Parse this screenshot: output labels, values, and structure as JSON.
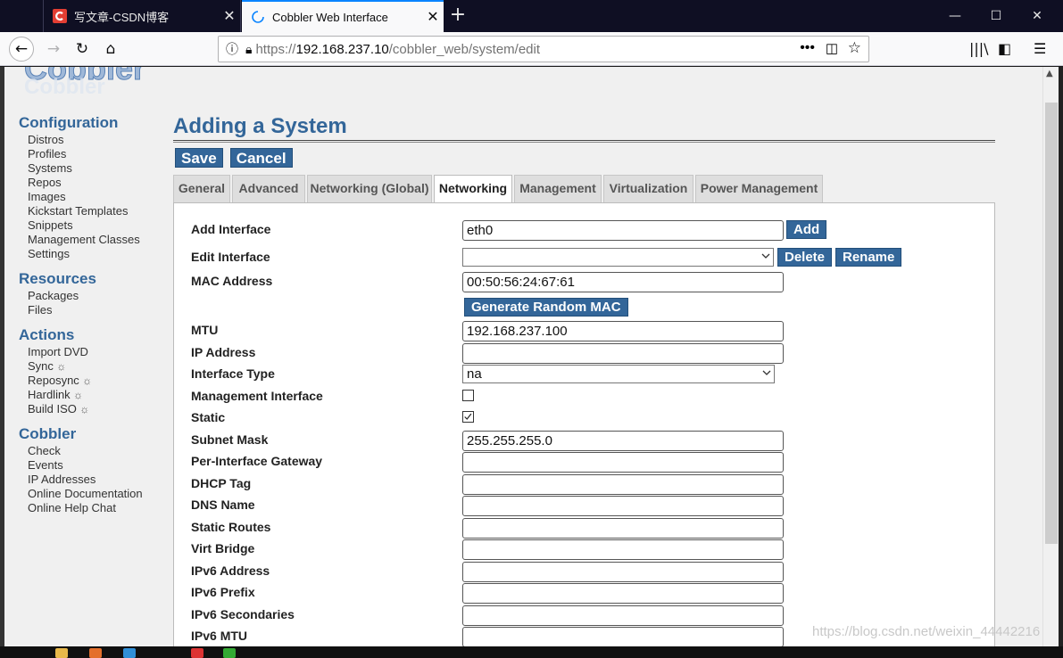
{
  "browser": {
    "tabs": [
      {
        "title": "写文章-CSDN博客",
        "active": false,
        "favicon": "csdn-c-logo"
      },
      {
        "title": "Cobbler Web Interface",
        "active": true,
        "favicon": "loading-spinner-icon"
      }
    ],
    "url": {
      "prefix": "https://",
      "host": "192.168.237.10",
      "path": "/cobbler_web/system/edit"
    },
    "colors": {
      "accent": "#0a84ff",
      "tab_bar": "#0f0f23"
    }
  },
  "page": {
    "logo_text": "Cobbler",
    "title": "Adding a System",
    "buttons": {
      "save": "Save",
      "cancel": "Cancel"
    },
    "colors": {
      "brand_blue": "#336699"
    }
  },
  "sidebar": {
    "sections": [
      {
        "heading": "Configuration",
        "items": [
          {
            "label": "Distros"
          },
          {
            "label": "Profiles"
          },
          {
            "label": "Systems"
          },
          {
            "label": "Repos"
          },
          {
            "label": "Images"
          },
          {
            "label": "Kickstart Templates"
          },
          {
            "label": "Snippets"
          },
          {
            "label": "Management Classes"
          },
          {
            "label": "Settings"
          }
        ]
      },
      {
        "heading": "Resources",
        "items": [
          {
            "label": "Packages"
          },
          {
            "label": "Files"
          }
        ]
      },
      {
        "heading": "Actions",
        "items": [
          {
            "label": "Import DVD"
          },
          {
            "label": "Sync",
            "icon": "sun-icon"
          },
          {
            "label": "Reposync",
            "icon": "sun-icon"
          },
          {
            "label": "Hardlink",
            "icon": "sun-icon"
          },
          {
            "label": "Build ISO",
            "icon": "sun-icon"
          }
        ]
      },
      {
        "heading": "Cobbler",
        "items": [
          {
            "label": "Check"
          },
          {
            "label": "Events"
          },
          {
            "label": "IP Addresses"
          },
          {
            "label": "Online Documentation"
          },
          {
            "label": "Online Help Chat"
          }
        ]
      }
    ]
  },
  "tabs": [
    {
      "label": "General"
    },
    {
      "label": "Advanced"
    },
    {
      "label": "Networking (Global)"
    },
    {
      "label": "Networking",
      "active": true
    },
    {
      "label": "Management"
    },
    {
      "label": "Virtualization"
    },
    {
      "label": "Power Management"
    }
  ],
  "form": {
    "add_interface": {
      "label": "Add Interface",
      "value": "eth0",
      "button": "Add"
    },
    "edit_interface": {
      "label": "Edit Interface",
      "value": "",
      "delete": "Delete",
      "rename": "Rename"
    },
    "mac_address": {
      "label": "MAC Address",
      "value": "00:50:56:24:67:61",
      "generate": "Generate Random MAC"
    },
    "mtu": {
      "label": "MTU",
      "value": "192.168.237.100"
    },
    "ip_address": {
      "label": "IP Address",
      "value": ""
    },
    "interface_type": {
      "label": "Interface Type",
      "value": "na"
    },
    "management_interface": {
      "label": "Management Interface",
      "checked": false
    },
    "static": {
      "label": "Static",
      "checked": true
    },
    "subnet_mask": {
      "label": "Subnet Mask",
      "value": "255.255.255.0"
    },
    "per_interface_gateway": {
      "label": "Per-Interface Gateway",
      "value": ""
    },
    "dhcp_tag": {
      "label": "DHCP Tag",
      "value": ""
    },
    "dns_name": {
      "label": "DNS Name",
      "value": ""
    },
    "static_routes": {
      "label": "Static Routes",
      "value": ""
    },
    "virt_bridge": {
      "label": "Virt Bridge",
      "value": ""
    },
    "ipv6_address": {
      "label": "IPv6 Address",
      "value": ""
    },
    "ipv6_prefix": {
      "label": "IPv6 Prefix",
      "value": ""
    },
    "ipv6_secondaries": {
      "label": "IPv6 Secondaries",
      "value": ""
    },
    "ipv6_mtu": {
      "label": "IPv6 MTU",
      "value": ""
    }
  },
  "watermark": "https://blog.csdn.net/weixin_44442216"
}
